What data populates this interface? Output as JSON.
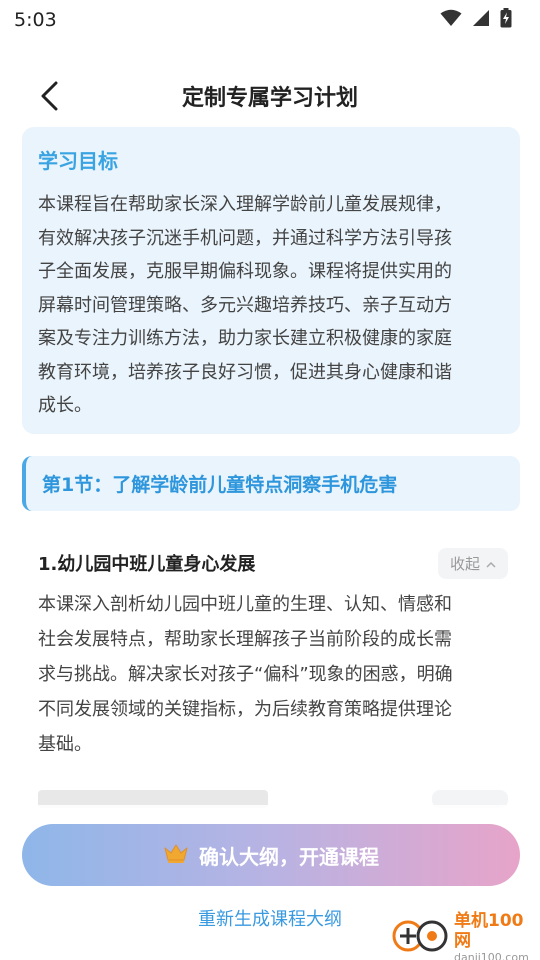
{
  "status_bar": {
    "time": "5:03",
    "icons": [
      "wifi-icon",
      "signal-icon",
      "battery-charging-icon"
    ]
  },
  "header": {
    "title": "定制专属学习计划",
    "back_icon": "chevron-left-icon"
  },
  "goal": {
    "title": "学习目标",
    "lines": [
      "本课程旨在帮助家长深入理解学龄前儿童发展规律，",
      "有效解决孩子沉迷手机问题，并通过科学方法引导孩",
      "子全面发展，克服早期偏科现象。课程将提供实用的",
      "屏幕时间管理策略、多元兴趣培养技巧、亲子互动方",
      "案及专注力训练方法，助力家长建立积极健康的家庭",
      "教育环境，培养孩子良好习惯，促进其身心健康和谐",
      "成长。"
    ]
  },
  "section": {
    "title": "第1节：了解学龄前儿童特点洞察手机危害"
  },
  "lesson1": {
    "title": "1.幼儿园中班儿童身心发展",
    "collapse_label": "收起",
    "lines": [
      "本课深入剖析幼儿园中班儿童的生理、认知、情感和",
      "社会发展特点，帮助家长理解孩子当前阶段的成长需",
      "求与挑战。解决家长对孩子“偏科”现象的困惑，明确",
      "不同发展领域的关键指标，为后续教育策略提供理论",
      "基础。"
    ]
  },
  "actions": {
    "confirm_label": "确认大纲，开通课程",
    "crown_icon": "crown-icon",
    "regenerate_label": "重新生成课程大纲"
  },
  "watermark": {
    "main": "单机100网",
    "sub": "danji100.com"
  },
  "colors": {
    "accent": "#3aa4e3",
    "card_bg": "#eaf4fc",
    "button_gradient_start": "#8fb6e9",
    "button_gradient_end": "#e7a4c9",
    "crown": "#f0a830",
    "watermark_orange": "#f07b16"
  }
}
